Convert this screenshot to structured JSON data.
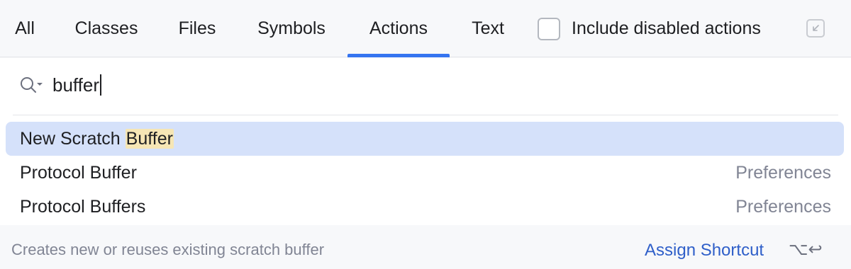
{
  "tabs": [
    {
      "label": "All"
    },
    {
      "label": "Classes"
    },
    {
      "label": "Files"
    },
    {
      "label": "Symbols"
    },
    {
      "label": "Actions"
    },
    {
      "label": "Text"
    }
  ],
  "active_tab": "Actions",
  "include_disabled": {
    "label": "Include disabled actions",
    "checked": false
  },
  "search": {
    "value": "buffer"
  },
  "results": [
    {
      "name_prefix": "New Scratch ",
      "name_match": "Buffer",
      "category": "",
      "selected": true
    },
    {
      "name": "Protocol Buffer",
      "category": "Preferences"
    },
    {
      "name": "Protocol Buffers",
      "category": "Preferences"
    }
  ],
  "footer": {
    "description": "Creates new or reuses existing scratch buffer",
    "assign_label": "Assign Shortcut",
    "shortcut": "⌥↩"
  },
  "colors": {
    "accent": "#3574f0",
    "selection": "#d5e1fa",
    "match_highlight": "#f6e6b5",
    "link": "#2f5fc9"
  }
}
